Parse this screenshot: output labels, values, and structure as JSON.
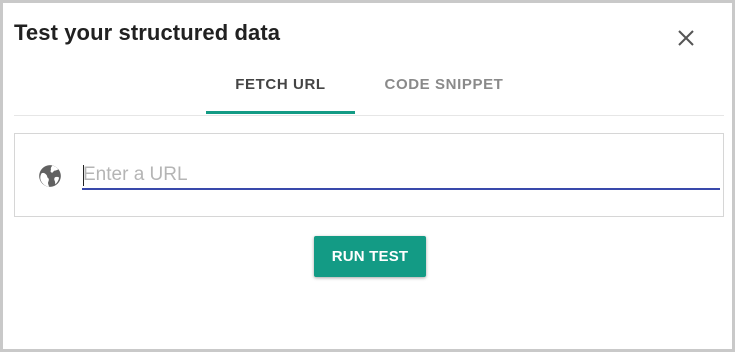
{
  "dialog": {
    "title": "Test your structured data",
    "close_icon": "close-icon"
  },
  "tabs": [
    {
      "label": "FETCH URL",
      "active": true
    },
    {
      "label": "CODE SNIPPET",
      "active": false
    }
  ],
  "url_input": {
    "placeholder": "Enter a URL",
    "value": "",
    "icon": "globe-icon"
  },
  "run_button": {
    "label": "RUN TEST"
  },
  "colors": {
    "accent": "#139b85",
    "input_underline": "#3949ab",
    "title_text": "#212121",
    "inactive_tab_text": "#8a8a8a"
  }
}
